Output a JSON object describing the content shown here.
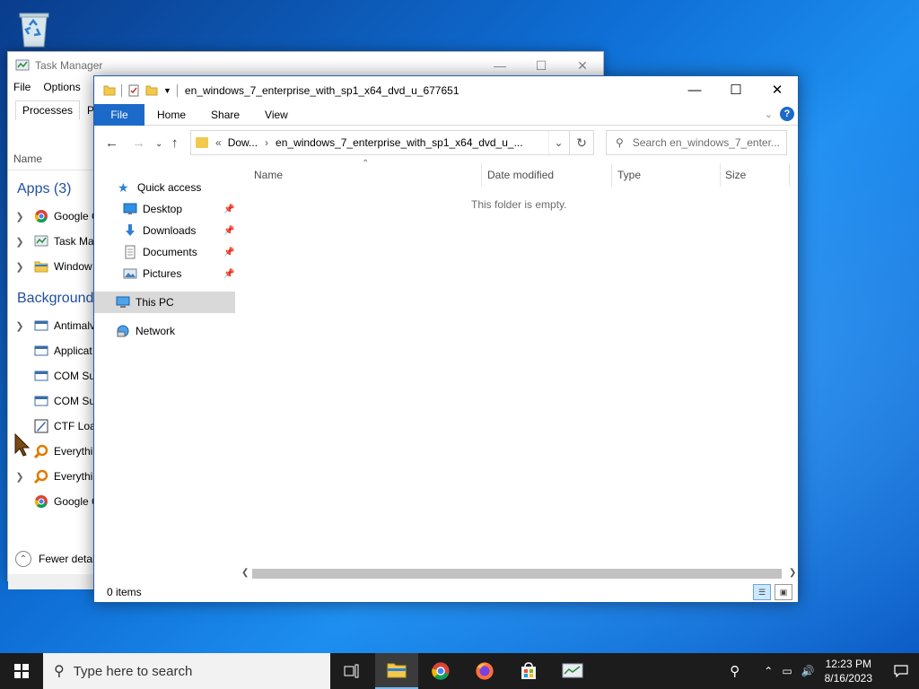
{
  "task_manager": {
    "title": "Task Manager",
    "menu": [
      "File",
      "Options"
    ],
    "tabs": [
      "Processes",
      "Perfo"
    ],
    "column_name": "Name",
    "group_apps": "Apps (3)",
    "group_background": "Background",
    "rows": [
      {
        "label": "Google C",
        "expand": true
      },
      {
        "label": "Task Man",
        "expand": true
      },
      {
        "label": "Window",
        "expand": true
      },
      {
        "label": "Antimalv",
        "expand": true
      },
      {
        "label": "Applicat",
        "expand": false
      },
      {
        "label": "COM Su",
        "expand": false
      },
      {
        "label": "COM Su",
        "expand": false
      },
      {
        "label": "CTF Loac",
        "expand": false
      },
      {
        "label": "Everythi",
        "expand": false
      },
      {
        "label": "Everythi",
        "expand": true
      },
      {
        "label": "Google C",
        "expand": false
      }
    ],
    "footer": "Fewer detail"
  },
  "explorer": {
    "title": "en_windows_7_enterprise_with_sp1_x64_dvd_u_677651",
    "ribbon_tabs": {
      "file": "File",
      "home": "Home",
      "share": "Share",
      "view": "View"
    },
    "address": {
      "prefix": "«",
      "crumb1": "Dow...",
      "crumb2": "en_windows_7_enterprise_with_sp1_x64_dvd_u_..."
    },
    "search_placeholder": "Search en_windows_7_enter...",
    "nav": {
      "quick_access": "Quick access",
      "desktop": "Desktop",
      "downloads": "Downloads",
      "documents": "Documents",
      "pictures": "Pictures",
      "this_pc": "This PC",
      "network": "Network"
    },
    "columns": {
      "name": "Name",
      "date": "Date modified",
      "type": "Type",
      "size": "Size"
    },
    "empty_text": "This folder is empty.",
    "status": "0 items"
  },
  "taskbar": {
    "search_placeholder": "Type here to search",
    "time": "12:23 PM",
    "date": "8/16/2023"
  },
  "colors": {
    "accent": "#1b6ac9",
    "taskbar": "#1c1c1c"
  }
}
